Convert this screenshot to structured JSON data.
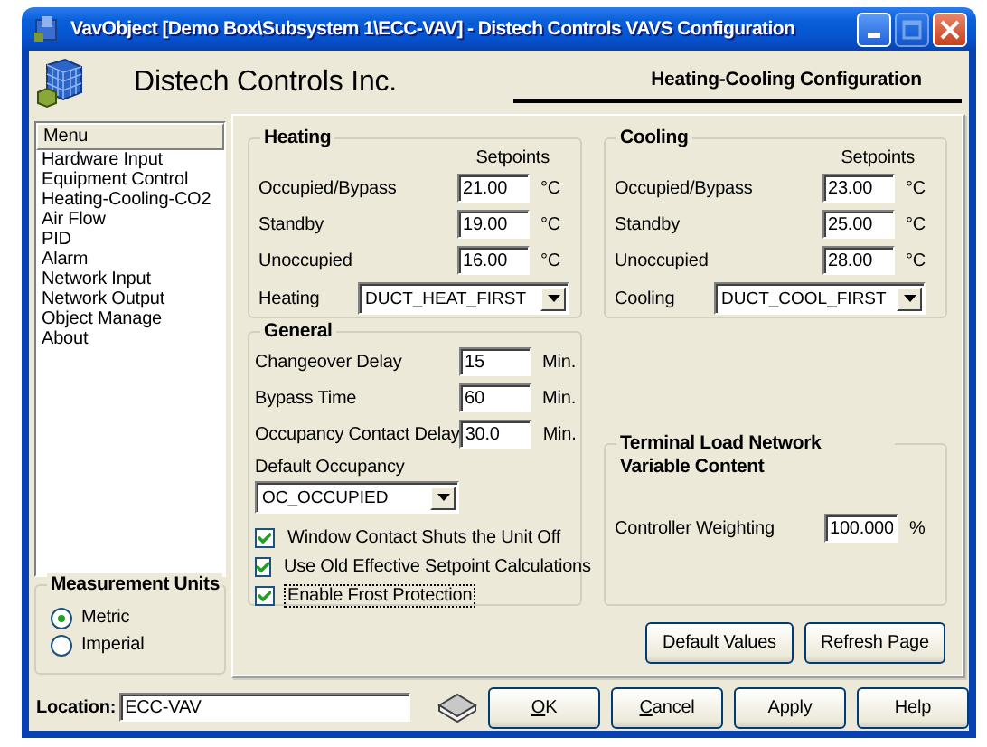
{
  "window": {
    "title": "VavObject [Demo Box\\Subsystem 1\\ECC-VAV] - Distech Controls VAVS Configuration",
    "maximize_disabled": true
  },
  "header": {
    "company": "Distech Controls Inc.",
    "page_title": "Heating-Cooling Configuration"
  },
  "menu": {
    "heading": "Menu",
    "items": [
      {
        "label": "Hardware Input"
      },
      {
        "label": "Equipment Control"
      },
      {
        "label": "Heating-Cooling-CO2"
      },
      {
        "label": "Air Flow"
      },
      {
        "label": "PID"
      },
      {
        "label": "Alarm"
      },
      {
        "label": "Network Input"
      },
      {
        "label": "Network Output"
      },
      {
        "label": "Object Manage"
      },
      {
        "label": "About"
      }
    ]
  },
  "measurement_units": {
    "title": "Measurement Units",
    "options": [
      {
        "label": "Metric",
        "selected": true
      },
      {
        "label": "Imperial",
        "selected": false
      }
    ]
  },
  "heating": {
    "title": "Heating",
    "setpoints_heading": "Setpoints",
    "setpoints": [
      {
        "label": "Occupied/Bypass",
        "value": "21.00",
        "unit": "°C"
      },
      {
        "label": "Standby",
        "value": "19.00",
        "unit": "°C"
      },
      {
        "label": "Unoccupied",
        "value": "16.00",
        "unit": "°C"
      }
    ],
    "mode": {
      "label": "Heating",
      "value": "DUCT_HEAT_FIRST"
    }
  },
  "general": {
    "title": "General",
    "fields": [
      {
        "label": "Changeover Delay",
        "value": "15",
        "unit": "Min."
      },
      {
        "label": "Bypass Time",
        "value": "60",
        "unit": "Min."
      },
      {
        "label": "Occupancy Contact Delay",
        "value": "30.0",
        "unit": "Min."
      }
    ],
    "default_occupancy": {
      "label": "Default Occupancy",
      "value": "OC_OCCUPIED"
    },
    "options": [
      {
        "label": "Window Contact Shuts the Unit Off",
        "checked": true,
        "focused": false
      },
      {
        "label": "Use Old Effective Setpoint Calculations",
        "checked": true,
        "focused": false
      },
      {
        "label": "Enable Frost Protection",
        "checked": true,
        "focused": true
      }
    ]
  },
  "cooling": {
    "title": "Cooling",
    "setpoints_heading": "Setpoints",
    "setpoints": [
      {
        "label": "Occupied/Bypass",
        "value": "23.00",
        "unit": "°C"
      },
      {
        "label": "Standby",
        "value": "25.00",
        "unit": "°C"
      },
      {
        "label": "Unoccupied",
        "value": "28.00",
        "unit": "°C"
      }
    ],
    "mode": {
      "label": "Cooling",
      "value": "DUCT_COOL_FIRST"
    }
  },
  "terminal_load": {
    "title": "Terminal Load Network Variable Content",
    "fields": [
      {
        "label": "Controller Weighting",
        "value": "100.000",
        "unit": "%"
      }
    ]
  },
  "page_buttons": [
    {
      "label": "Default Values"
    },
    {
      "label": "Refresh Page"
    }
  ],
  "location": {
    "label": "Location:",
    "value": "ECC-VAV"
  },
  "dialog_buttons": [
    {
      "mnemonic": "O",
      "label_rest": "K"
    },
    {
      "mnemonic": "C",
      "label_rest": "ancel"
    },
    {
      "label": "Apply"
    },
    {
      "label": "Help"
    }
  ]
}
